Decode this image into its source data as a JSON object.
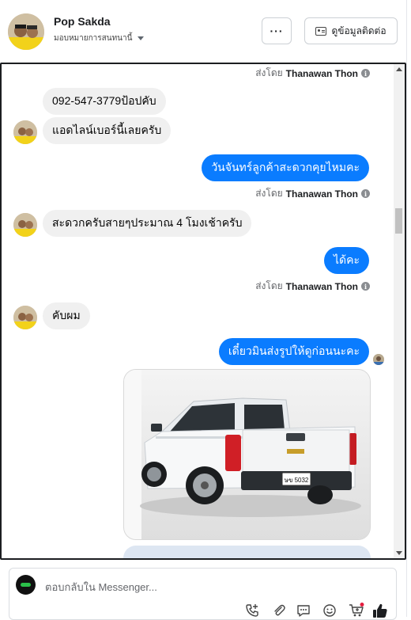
{
  "header": {
    "contact_name": "Pop Sakda",
    "assign_label": "มอบหมายการสนทนานี้",
    "more_label": "···",
    "contact_info_label": "ดูข้อมูลติดต่อ"
  },
  "sent_by": {
    "prefix": "ส่งโดย",
    "agent": "Thanawan Thon"
  },
  "messages": [
    {
      "from": "contact",
      "text": "092-547-3779ป้อปคับ"
    },
    {
      "from": "contact",
      "text": "แอดไลน์เบอร์นี้เลยครับ"
    },
    {
      "from": "page",
      "text": "วันจันทร์ลูกค้าสะดวกคุยไหมคะ"
    },
    {
      "from": "contact",
      "text": "สะดวกครับสายๆประมาณ 4 โมงเช้าครับ"
    },
    {
      "from": "page",
      "text": "ได้คะ"
    },
    {
      "from": "contact",
      "text": "คับผม"
    },
    {
      "from": "page",
      "text": "เดี๋ยวมินส่งรูปให้ดูก่อนนะคะ"
    }
  ],
  "photo": {
    "plate_text": "ษข 5032"
  },
  "composer": {
    "placeholder": "ตอบกลับใน Messenger..."
  },
  "colors": {
    "outgoing_bubble": "#0a7cff",
    "incoming_bubble": "#f0f0f0",
    "like_icon": "#1c1e21"
  },
  "icons": [
    "ellipsis-icon",
    "contact-card-icon",
    "info-icon",
    "call-icon",
    "attachment-icon",
    "chat-reply-icon",
    "emoji-icon",
    "cart-icon",
    "like-icon"
  ]
}
